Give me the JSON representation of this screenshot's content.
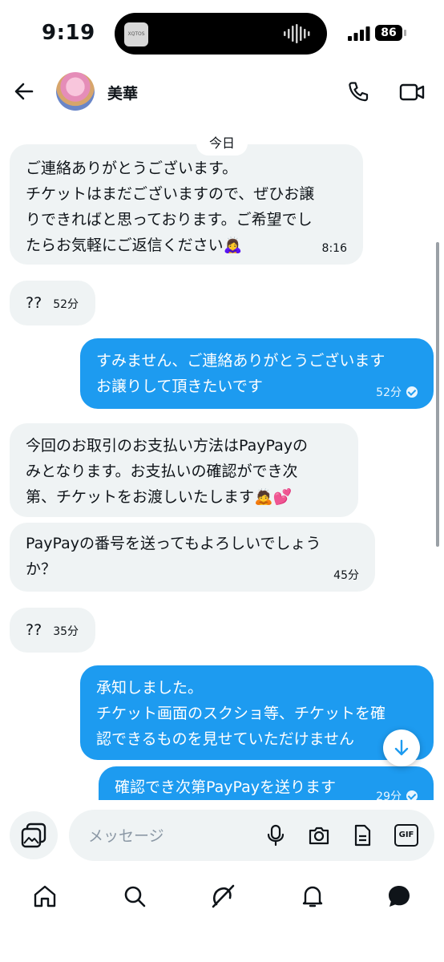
{
  "status_bar": {
    "time": "9:19",
    "battery": "86",
    "island_app_label": "XQTOS"
  },
  "header": {
    "contact_name": "美華"
  },
  "chat": {
    "date_divider": "今日",
    "messages": [
      {
        "dir": "in",
        "lines": [
          "ご連絡ありがとうございます。",
          "チケットはまだございますので、ぜひお譲",
          "りできればと思っております。ご希望でし",
          "たらお気軽にご返信ください🙇‍♀️"
        ],
        "time": "8:16"
      },
      {
        "dir": "in",
        "lines": [
          "??"
        ],
        "time": "52分"
      },
      {
        "dir": "out",
        "lines": [
          "すみません、ご連絡ありがとうございます",
          "お譲りして頂きたいです"
        ],
        "time": "52分"
      },
      {
        "dir": "in",
        "lines": [
          "今回のお取引のお支払い方法はPayPayの",
          "みとなります。お支払いの確認ができ次",
          "第、チケットをお渡しいたします🙇💕"
        ],
        "time": ""
      },
      {
        "dir": "in",
        "lines": [
          "PayPayの番号を送ってもよろしいでしょう",
          "か？"
        ],
        "time": "45分"
      },
      {
        "dir": "in",
        "lines": [
          "??"
        ],
        "time": "35分"
      },
      {
        "dir": "out",
        "lines": [
          "承知しました。",
          "チケット画面のスクショ等、チケットを確",
          "認できるものを見せていただけません"
        ],
        "time": ""
      },
      {
        "dir": "out",
        "lines": [
          "確認でき次第PayPayを送ります"
        ],
        "time": "29分"
      }
    ]
  },
  "composer": {
    "placeholder": "メッセージ",
    "gif_label": "GIF"
  },
  "colors": {
    "accent": "#1d9bf0",
    "incoming_bubble": "#eff3f4",
    "text": "#0f1419"
  },
  "icons": [
    "back-arrow-icon",
    "phone-icon",
    "video-camera-icon",
    "gallery-icon",
    "microphone-icon",
    "camera-icon",
    "document-icon",
    "gif-icon",
    "home-icon",
    "search-icon",
    "grok-icon",
    "bell-icon",
    "messages-icon",
    "scroll-down-arrow-icon"
  ]
}
